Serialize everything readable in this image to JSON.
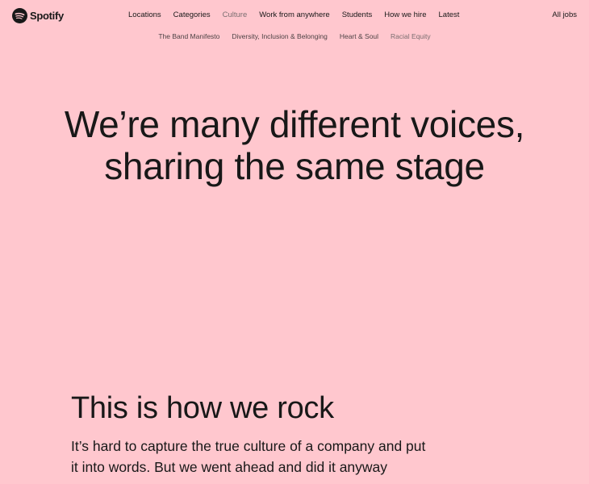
{
  "brand": {
    "name": "Spotify",
    "logo_icon": "spotify-logo-icon"
  },
  "main_nav": {
    "items": [
      {
        "label": "Locations"
      },
      {
        "label": "Categories"
      },
      {
        "label": "Culture",
        "active": true
      },
      {
        "label": "Work from anywhere"
      },
      {
        "label": "Students"
      },
      {
        "label": "How we hire"
      },
      {
        "label": "Latest"
      }
    ],
    "all_jobs_label": "All jobs"
  },
  "sub_nav": {
    "items": [
      {
        "label": "The Band Manifesto"
      },
      {
        "label": "Diversity, Inclusion & Belonging"
      },
      {
        "label": "Heart & Soul"
      },
      {
        "label": "Racial Equity",
        "active": true
      }
    ]
  },
  "hero": {
    "heading": "We’re many different voices, sharing the same stage"
  },
  "section": {
    "heading": "This is how we rock",
    "body": "It’s hard to capture the true culture of a company and put it into words. But we went ahead and did it anyway"
  },
  "colors": {
    "background": "#ffc7ce",
    "text": "#181818",
    "muted": "#7a6e70"
  }
}
